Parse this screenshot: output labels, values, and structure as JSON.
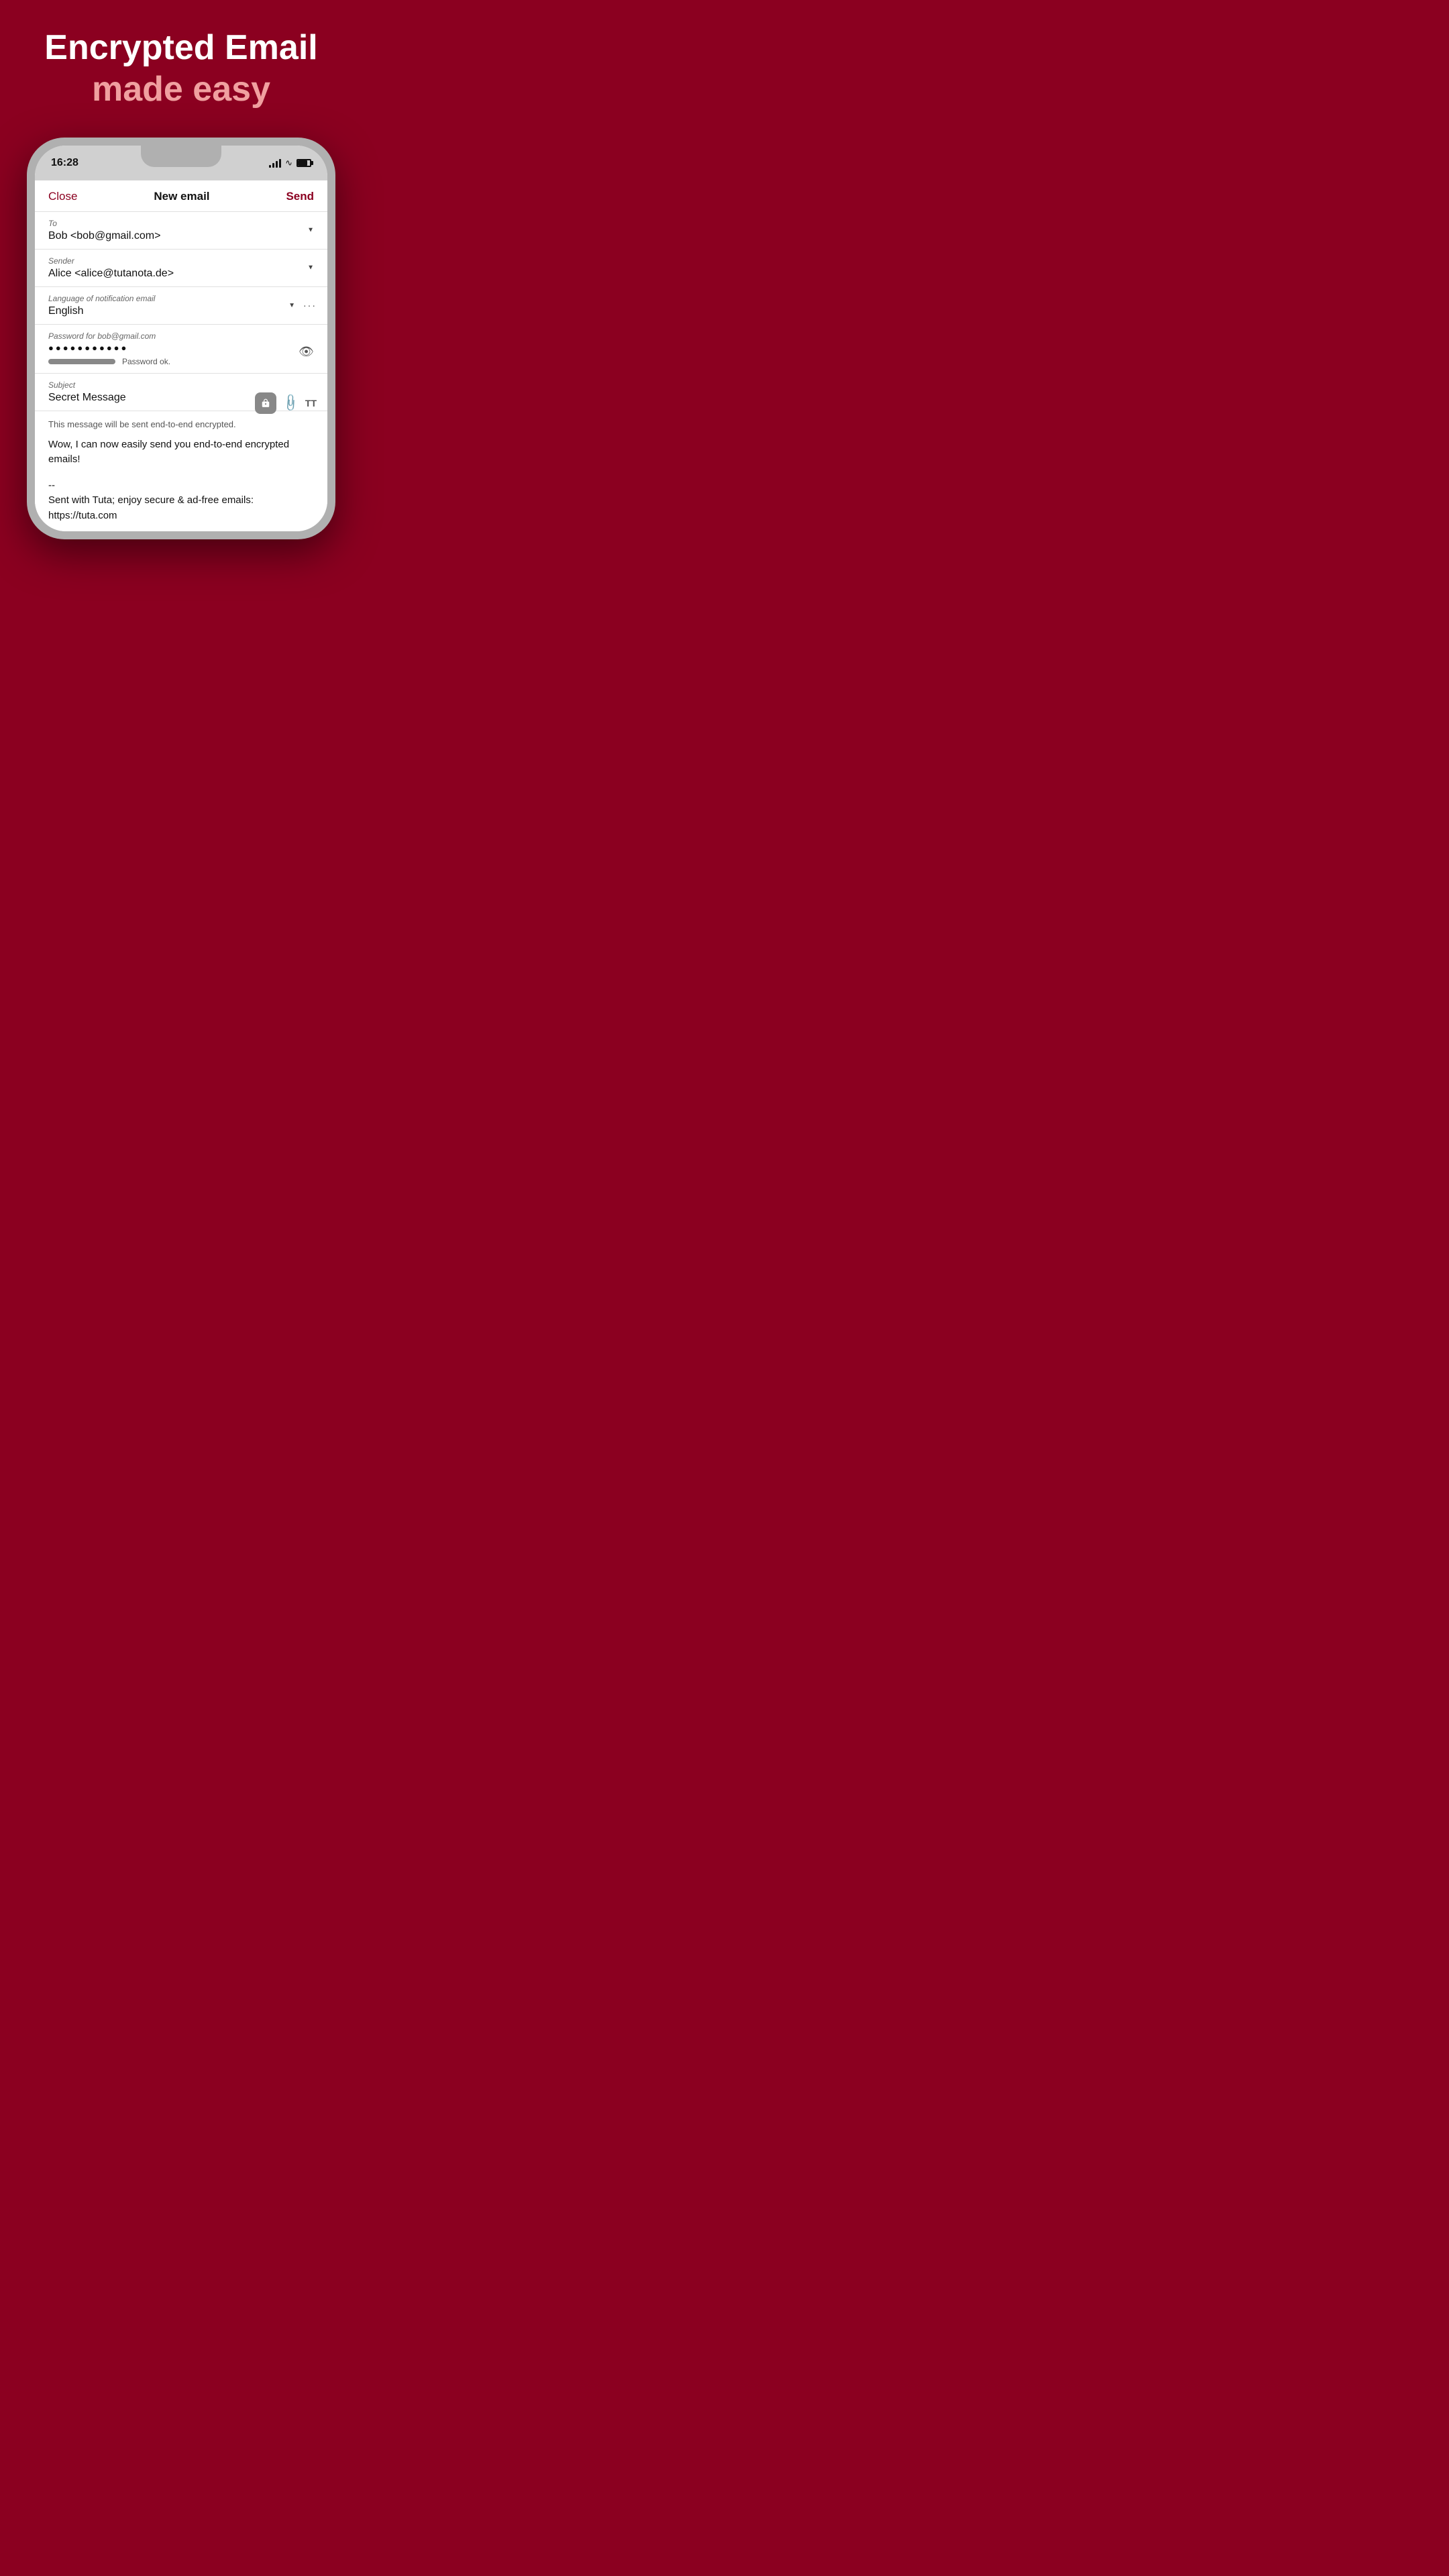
{
  "hero": {
    "line1": "Encrypted Email",
    "line2": "made easy"
  },
  "statusBar": {
    "time": "16:28",
    "batteryLevel": "80%"
  },
  "nav": {
    "close": "Close",
    "title": "New email",
    "send": "Send"
  },
  "fields": {
    "to_label": "To",
    "to_value": "Bob <bob@gmail.com>",
    "sender_label": "Sender",
    "sender_value": "Alice <alice@tutanota.de>",
    "lang_label": "Language of notification email",
    "lang_value": "English",
    "password_label": "Password for bob@gmail.com",
    "password_value": "●●●●●●●●●●●",
    "password_status": "Password ok.",
    "subject_label": "Subject",
    "subject_value": "Secret Message",
    "encryption_notice": "This message will be sent end-to-end encrypted.",
    "body_text": "Wow, I can now easily send you end-to-end encrypted emails!",
    "signature_line1": "--",
    "signature_line2": "Sent with Tuta; enjoy secure & ad-free emails: https://tuta.com"
  }
}
